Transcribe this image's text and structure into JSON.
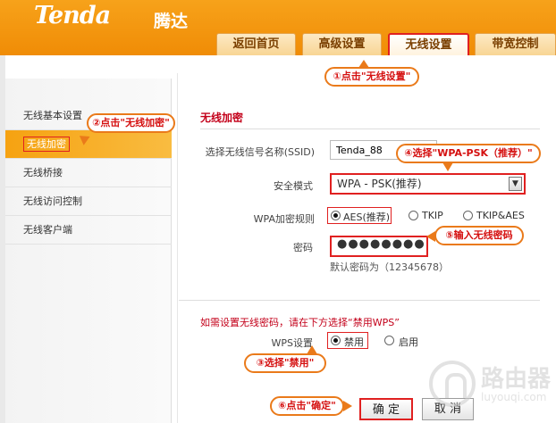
{
  "header": {
    "logo": "Tenda",
    "logo_cn": "腾达",
    "tabs": [
      {
        "label": "返回首页"
      },
      {
        "label": "高级设置"
      },
      {
        "label": "无线设置"
      },
      {
        "label": "带宽控制"
      }
    ]
  },
  "sidebar": {
    "items": [
      {
        "label": "无线基本设置"
      },
      {
        "label": "无线加密"
      },
      {
        "label": "无线桥接"
      },
      {
        "label": "无线访问控制"
      },
      {
        "label": "无线客户端"
      }
    ]
  },
  "form": {
    "section_title": "无线加密",
    "ssid_label": "选择无线信号名称(SSID)",
    "ssid_value": "Tenda_88",
    "mode_label": "安全模式",
    "mode_value": "WPA - PSK(推荐)",
    "rule_label": "WPA加密规则",
    "rule_options": [
      "AES(推荐)",
      "TKIP",
      "TKIP&AES"
    ],
    "password_label": "密码",
    "password_value": "●●●●●●●●",
    "password_hint": "默认密码为（12345678）",
    "wps_note": "如需设置无线密码，请在下方选择“禁用WPS”",
    "wps_label": "WPS设置",
    "wps_options": [
      "禁用",
      "启用"
    ]
  },
  "buttons": {
    "ok": "确 定",
    "cancel": "取 消"
  },
  "callouts": {
    "c1": "①点击\"无线设置\"",
    "c2": "②点击\"无线加密\"",
    "c3": "③选择\"禁用\"",
    "c4": "④选择\"WPA-PSK（推荐）\"",
    "c5": "⑤输入无线密码",
    "c6": "⑥点击\"确定\""
  },
  "watermark": {
    "text_cn": "路由器",
    "url": "luyouqi.com"
  }
}
